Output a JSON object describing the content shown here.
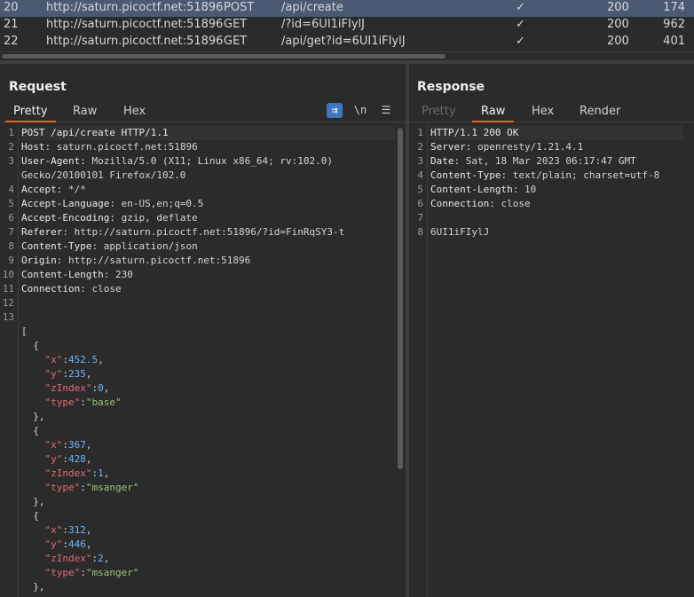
{
  "history": [
    {
      "num": "20",
      "host": "http://saturn.picoctf.net:51896",
      "method": "POST",
      "url": "/api/create",
      "edited": "✓",
      "status": "200",
      "length": "174",
      "selected": true
    },
    {
      "num": "21",
      "host": "http://saturn.picoctf.net:51896",
      "method": "GET",
      "url": "/?id=6UI1iFIylJ",
      "edited": "✓",
      "status": "200",
      "length": "962",
      "selected": false
    },
    {
      "num": "22",
      "host": "http://saturn.picoctf.net:51896",
      "method": "GET",
      "url": "/api/get?id=6UI1iFIylJ",
      "edited": "✓",
      "status": "200",
      "length": "401",
      "selected": false
    }
  ],
  "request": {
    "title": "Request",
    "tabs": [
      "Pretty",
      "Raw",
      "Hex"
    ],
    "active_tab": "Pretty",
    "tools": {
      "wrap": "⇉",
      "newline": "\\n",
      "menu": "☰"
    }
  },
  "response": {
    "title": "Response",
    "tabs": [
      "Pretty",
      "Raw",
      "Hex",
      "Render"
    ],
    "active_tab": "Raw",
    "disabled_tab": "Pretty"
  },
  "request_lines": [
    {
      "n": "1",
      "parts": [
        [
          "hdr",
          "POST /api/create HTTP/1.1"
        ]
      ]
    },
    {
      "n": "2",
      "parts": [
        [
          "hdr",
          "Host"
        ],
        [
          "punc",
          ": saturn.picoctf.net:51896"
        ]
      ]
    },
    {
      "n": "3",
      "parts": [
        [
          "hdr",
          "User-Agent"
        ],
        [
          "punc",
          ": Mozilla/5.0 (X11; Linux x86_64; rv:102.0)"
        ]
      ]
    },
    {
      "n": "",
      "parts": [
        [
          "punc",
          "Gecko/20100101 Firefox/102.0"
        ]
      ]
    },
    {
      "n": "4",
      "parts": [
        [
          "hdr",
          "Accept"
        ],
        [
          "punc",
          ": */*"
        ]
      ]
    },
    {
      "n": "5",
      "parts": [
        [
          "hdr",
          "Accept-Language"
        ],
        [
          "punc",
          ": en-US,en;q=0.5"
        ]
      ]
    },
    {
      "n": "6",
      "parts": [
        [
          "hdr",
          "Accept-Encoding"
        ],
        [
          "punc",
          ": gzip, deflate"
        ]
      ]
    },
    {
      "n": "7",
      "parts": [
        [
          "hdr",
          "Referer"
        ],
        [
          "punc",
          ": http://saturn.picoctf.net:51896/?id=FinRqSY3-t"
        ]
      ]
    },
    {
      "n": "8",
      "parts": [
        [
          "hdr",
          "Content-Type"
        ],
        [
          "punc",
          ": application/json"
        ]
      ]
    },
    {
      "n": "9",
      "parts": [
        [
          "hdr",
          "Origin"
        ],
        [
          "punc",
          ": http://saturn.picoctf.net:51896"
        ]
      ]
    },
    {
      "n": "10",
      "parts": [
        [
          "hdr",
          "Content-Length"
        ],
        [
          "punc",
          ": 230"
        ]
      ]
    },
    {
      "n": "11",
      "parts": [
        [
          "hdr",
          "Connection"
        ],
        [
          "punc",
          ": close"
        ]
      ]
    },
    {
      "n": "12",
      "parts": []
    },
    {
      "n": "13",
      "parts": []
    },
    {
      "n": "",
      "parts": [
        [
          "punc",
          "["
        ]
      ]
    },
    {
      "n": "",
      "parts": [
        [
          "punc",
          "  {"
        ]
      ]
    },
    {
      "n": "",
      "parts": [
        [
          "punc",
          "    "
        ],
        [
          "key",
          "\"x\""
        ],
        [
          "punc",
          ":"
        ],
        [
          "num",
          "452.5"
        ],
        [
          "punc",
          ","
        ]
      ]
    },
    {
      "n": "",
      "parts": [
        [
          "punc",
          "    "
        ],
        [
          "key",
          "\"y\""
        ],
        [
          "punc",
          ":"
        ],
        [
          "num",
          "235"
        ],
        [
          "punc",
          ","
        ]
      ]
    },
    {
      "n": "",
      "parts": [
        [
          "punc",
          "    "
        ],
        [
          "key",
          "\"zIndex\""
        ],
        [
          "punc",
          ":"
        ],
        [
          "num",
          "0"
        ],
        [
          "punc",
          ","
        ]
      ]
    },
    {
      "n": "",
      "parts": [
        [
          "punc",
          "    "
        ],
        [
          "key",
          "\"type\""
        ],
        [
          "punc",
          ":"
        ],
        [
          "str",
          "\"base\""
        ]
      ]
    },
    {
      "n": "",
      "parts": [
        [
          "punc",
          "  },"
        ]
      ]
    },
    {
      "n": "",
      "parts": [
        [
          "punc",
          "  {"
        ]
      ]
    },
    {
      "n": "",
      "parts": [
        [
          "punc",
          "    "
        ],
        [
          "key",
          "\"x\""
        ],
        [
          "punc",
          ":"
        ],
        [
          "num",
          "367"
        ],
        [
          "punc",
          ","
        ]
      ]
    },
    {
      "n": "",
      "parts": [
        [
          "punc",
          "    "
        ],
        [
          "key",
          "\"y\""
        ],
        [
          "punc",
          ":"
        ],
        [
          "num",
          "428"
        ],
        [
          "punc",
          ","
        ]
      ]
    },
    {
      "n": "",
      "parts": [
        [
          "punc",
          "    "
        ],
        [
          "key",
          "\"zIndex\""
        ],
        [
          "punc",
          ":"
        ],
        [
          "num",
          "1"
        ],
        [
          "punc",
          ","
        ]
      ]
    },
    {
      "n": "",
      "parts": [
        [
          "punc",
          "    "
        ],
        [
          "key",
          "\"type\""
        ],
        [
          "punc",
          ":"
        ],
        [
          "str",
          "\"msanger\""
        ]
      ]
    },
    {
      "n": "",
      "parts": [
        [
          "punc",
          "  },"
        ]
      ]
    },
    {
      "n": "",
      "parts": [
        [
          "punc",
          "  {"
        ]
      ]
    },
    {
      "n": "",
      "parts": [
        [
          "punc",
          "    "
        ],
        [
          "key",
          "\"x\""
        ],
        [
          "punc",
          ":"
        ],
        [
          "num",
          "312"
        ],
        [
          "punc",
          ","
        ]
      ]
    },
    {
      "n": "",
      "parts": [
        [
          "punc",
          "    "
        ],
        [
          "key",
          "\"y\""
        ],
        [
          "punc",
          ":"
        ],
        [
          "num",
          "446"
        ],
        [
          "punc",
          ","
        ]
      ]
    },
    {
      "n": "",
      "parts": [
        [
          "punc",
          "    "
        ],
        [
          "key",
          "\"zIndex\""
        ],
        [
          "punc",
          ":"
        ],
        [
          "num",
          "2"
        ],
        [
          "punc",
          ","
        ]
      ]
    },
    {
      "n": "",
      "parts": [
        [
          "punc",
          "    "
        ],
        [
          "key",
          "\"type\""
        ],
        [
          "punc",
          ":"
        ],
        [
          "str",
          "\"msanger\""
        ]
      ]
    },
    {
      "n": "",
      "parts": [
        [
          "punc",
          "  },"
        ]
      ]
    },
    {
      "n": "",
      "parts": [
        [
          "punc",
          "  {"
        ]
      ]
    }
  ],
  "response_lines": [
    {
      "n": "1",
      "parts": [
        [
          "hdr",
          "HTTP/1.1 200 OK"
        ]
      ]
    },
    {
      "n": "2",
      "parts": [
        [
          "hdr",
          "Server"
        ],
        [
          "punc",
          ": openresty/1.21.4.1"
        ]
      ]
    },
    {
      "n": "3",
      "parts": [
        [
          "hdr",
          "Date"
        ],
        [
          "punc",
          ": Sat, 18 Mar 2023 06:17:47 GMT"
        ]
      ]
    },
    {
      "n": "4",
      "parts": [
        [
          "hdr",
          "Content-Type"
        ],
        [
          "punc",
          ": text/plain; charset=utf-8"
        ]
      ]
    },
    {
      "n": "5",
      "parts": [
        [
          "hdr",
          "Content-Length"
        ],
        [
          "punc",
          ": 10"
        ]
      ]
    },
    {
      "n": "6",
      "parts": [
        [
          "hdr",
          "Connection"
        ],
        [
          "punc",
          ": close"
        ]
      ]
    },
    {
      "n": "7",
      "parts": []
    },
    {
      "n": "8",
      "parts": [
        [
          "punc",
          "6UI1iFIylJ"
        ]
      ]
    }
  ],
  "colors": {
    "selected_row": "#4a5a73",
    "accent_tab": "#e8642c",
    "wrap_button": "#3d77c0"
  }
}
